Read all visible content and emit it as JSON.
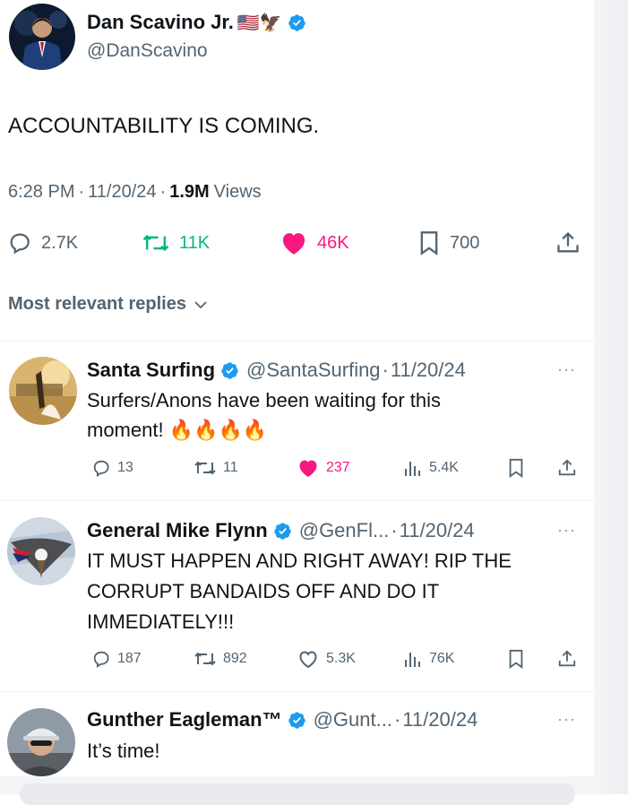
{
  "main_tweet": {
    "author_name": "Dan Scavino Jr.",
    "author_emojis": "🇺🇸🦅",
    "handle": "@DanScavino",
    "text": "ACCOUNTABILITY IS COMING.",
    "time": "6:28 PM",
    "date": "11/20/24",
    "views_count": "1.9M",
    "views_label": "Views",
    "replies": "2.7K",
    "reposts": "11K",
    "likes": "46K",
    "bookmarks": "700"
  },
  "sort": {
    "label": "Most relevant replies"
  },
  "replies": [
    {
      "name": "Santa Surfing",
      "handle": "@SantaSurfing",
      "date": "11/20/24",
      "text_line1": "Surfers/Anons have been waiting for this",
      "text_line2": "moment! 🔥🔥🔥🔥",
      "replies": "13",
      "reposts": "11",
      "likes": "237",
      "views": "5.4K",
      "liked": true
    },
    {
      "name": "General Mike Flynn",
      "handle": "@GenFl...",
      "date": "11/20/24",
      "text_line1": "IT MUST HAPPEN AND RIGHT AWAY! RIP THE",
      "text_line2": "CORRUPT BANDAIDS OFF AND DO IT",
      "text_line3": "IMMEDIATELY!!!",
      "replies": "187",
      "reposts": "892",
      "likes": "5.3K",
      "views": "76K",
      "liked": false
    },
    {
      "name": "Gunther Eagleman™",
      "handle": "@Gunt...",
      "date": "11/20/24",
      "text_line1": "It’s time!"
    }
  ],
  "separator": "·",
  "more_label": "···",
  "colors": {
    "verified": "#1d9bf0",
    "repost": "#00ba7c",
    "like": "#f91880",
    "muted": "#536471"
  }
}
